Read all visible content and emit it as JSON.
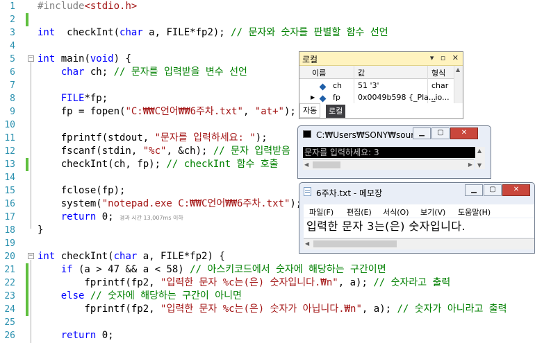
{
  "editor": {
    "line_numbers": [
      "1",
      "2",
      "3",
      "4",
      "5",
      "6",
      "7",
      "8",
      "9",
      "10",
      "11",
      "12",
      "13",
      "14",
      "15",
      "16",
      "17",
      "18",
      "19",
      "20",
      "21",
      "22",
      "23",
      "24",
      "25",
      "26"
    ],
    "lines": [
      [
        [
          "pp",
          "#include"
        ],
        [
          "st",
          "<stdio.h>"
        ]
      ],
      [],
      [
        [
          "kw",
          "int"
        ],
        [
          "",
          "  checkInt("
        ],
        [
          "kw",
          "char"
        ],
        [
          "",
          " a, FILE*fp2); "
        ],
        [
          "cm",
          "// 문자와 숫자를 판별할 함수 선언"
        ]
      ],
      [],
      [
        [
          "kw",
          "int"
        ],
        [
          "",
          " main("
        ],
        [
          "kw",
          "void"
        ],
        [
          "",
          ") {"
        ]
      ],
      [
        [
          "",
          "    "
        ],
        [
          "kw",
          "char"
        ],
        [
          "",
          " ch; "
        ],
        [
          "cm",
          "// 문자를 입력받을 변수 선언"
        ]
      ],
      [],
      [
        [
          "",
          "    "
        ],
        [
          "kw",
          "FILE"
        ],
        [
          "",
          "*fp;"
        ]
      ],
      [
        [
          "",
          "    fp = fopen("
        ],
        [
          "st",
          "\"C:₩₩C언어₩₩6주차.txt\""
        ],
        [
          "",
          ", "
        ],
        [
          "st",
          "\"at+\""
        ],
        [
          "",
          ");"
        ]
      ],
      [],
      [
        [
          "",
          "    fprintf(stdout, "
        ],
        [
          "st",
          "\"문자를 입력하세요: \""
        ],
        [
          "",
          ");"
        ]
      ],
      [
        [
          "",
          "    fscanf(stdin, "
        ],
        [
          "st",
          "\"%c\""
        ],
        [
          "",
          ", &ch); "
        ],
        [
          "cm",
          "// 문자 입력받음"
        ]
      ],
      [
        [
          "",
          "    checkInt(ch, fp); "
        ],
        [
          "cm",
          "// checkInt 함수 호출"
        ]
      ],
      [],
      [
        [
          "",
          "    fclose(fp);"
        ]
      ],
      [
        [
          "",
          "    system("
        ],
        [
          "st",
          "\"notepad.exe C:₩₩C언어₩₩6주차.txt\""
        ],
        [
          "",
          ");"
        ]
      ],
      [
        [
          "",
          "    "
        ],
        [
          "kw",
          "return"
        ],
        [
          "",
          " 0; "
        ],
        [
          "hint",
          "경과 시간 13,007ms 이하"
        ]
      ],
      [
        [
          "",
          "}"
        ]
      ],
      [],
      [
        [
          "kw",
          "int"
        ],
        [
          "",
          " checkInt("
        ],
        [
          "kw",
          "char"
        ],
        [
          "",
          " a, FILE*fp2) {"
        ]
      ],
      [
        [
          "",
          "    "
        ],
        [
          "kw",
          "if"
        ],
        [
          "",
          " (a > 47 && a < 58) "
        ],
        [
          "cm",
          "// 아스키코드에서 숫자에 해당하는 구간이면"
        ]
      ],
      [
        [
          "",
          "        fprintf(fp2, "
        ],
        [
          "st",
          "\"입력한 문자 %c는(은) 숫자입니다.₩n\""
        ],
        [
          "",
          ", a); "
        ],
        [
          "cm",
          "// 숫자라고 출력"
        ]
      ],
      [
        [
          "",
          "    "
        ],
        [
          "kw",
          "else"
        ],
        [
          "cm",
          " // 숫자에 해당하는 구간이 아니면"
        ]
      ],
      [
        [
          "",
          "        fprintf(fp2, "
        ],
        [
          "st",
          "\"입력한 문자 %c는(은) 숫자가 아닙니다.₩n\""
        ],
        [
          "",
          ", a); "
        ],
        [
          "cm",
          "// 숫자가 아니라고 출력"
        ]
      ],
      [],
      [
        [
          "",
          "    "
        ],
        [
          "kw",
          "return"
        ],
        [
          "",
          " 0;"
        ]
      ]
    ]
  },
  "locals": {
    "title": "로컬",
    "title_buttons": "▾ ▫ ✕",
    "columns": [
      "이름",
      "값",
      "형식"
    ],
    "rows": [
      {
        "name": "ch",
        "value": "51 '3'",
        "type": "char",
        "expandable": false
      },
      {
        "name": "fp",
        "value": "0x0049b598 {_Pla...",
        "type": "_io...",
        "expandable": true
      }
    ],
    "tabs": [
      "자동",
      "로컬"
    ],
    "active_tab": "로컬"
  },
  "console": {
    "title": "C:₩Users₩SONY₩sour...",
    "minimize": "▁",
    "maximize": "▢",
    "close": "✕",
    "output": "문자를 입력하세요: 3"
  },
  "notepad": {
    "title": "6주차.txt - 메모장",
    "minimize": "▁",
    "maximize": "▢",
    "close": "✕",
    "menu": [
      "파일(F)",
      "편집(E)",
      "서식(O)",
      "보기(V)",
      "도움말(H)"
    ],
    "content": "입력한 문자 3는(은) 숫자입니다."
  },
  "colors": {
    "keyword": "#0000ff",
    "comment": "#008000",
    "string": "#a31515",
    "line_number": "#2b91af",
    "change_bar": "#5fbf3f",
    "locals_title_bg": "#fff3bf"
  }
}
